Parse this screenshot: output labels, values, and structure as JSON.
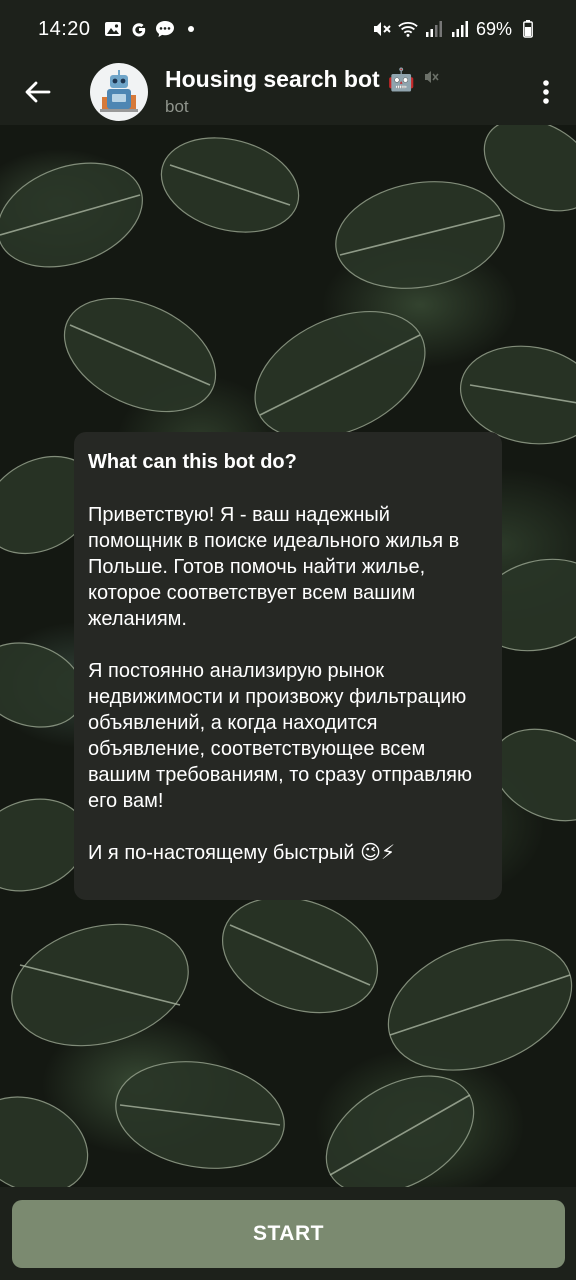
{
  "status_bar": {
    "time": "14:20",
    "left_icons": [
      "gallery-icon",
      "google-icon",
      "message-icon",
      "dot-icon"
    ],
    "right_icons": [
      "mute-icon",
      "wifi-icon",
      "signal-icon",
      "signal-icon"
    ],
    "battery": "69%"
  },
  "header": {
    "title": "Housing search bot",
    "title_emoji": "🤖",
    "subtitle": "bot",
    "muted": true
  },
  "info_card": {
    "title": "What can this bot do?",
    "paragraphs": [
      "Приветствую! Я - ваш надежный помощник в поиске идеального жилья в Польше. Готов помочь найти жилье, которое соответствует всем вашим желаниям.",
      "Я постоянно анализирую рынок недвижимости и произвожу фильтрацию объявлений, а когда находится объявление, соответствующее всем вашим требованиям, то сразу отправляю его вам!",
      "И я по-настоящему быстрый 😉⚡"
    ]
  },
  "bottom": {
    "start_label": "START"
  },
  "colors": {
    "bar_bg": "#1d211b",
    "card_bg": "#262824",
    "start_button": "#7b8a70",
    "subtitle": "#8f948c"
  }
}
